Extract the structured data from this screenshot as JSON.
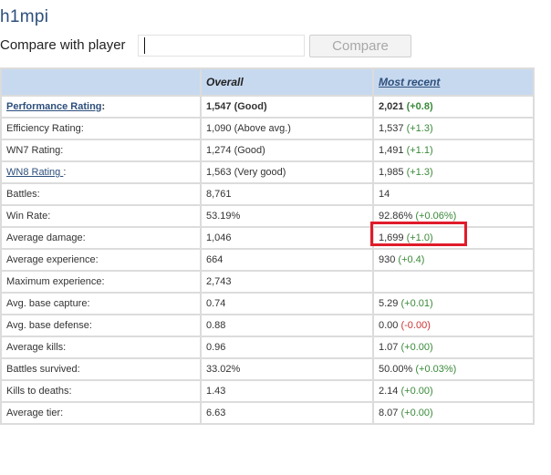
{
  "player": {
    "name": "h1mpi"
  },
  "compare": {
    "label": "Compare with player",
    "input_value": "",
    "placeholder": "",
    "button_label": "Compare"
  },
  "table": {
    "headers": {
      "label": "",
      "overall": "Overall",
      "recent": "Most recent"
    },
    "rows": [
      {
        "label": "Performance Rating",
        "label_suffix": ":",
        "overall": "1,547 (Good)",
        "recent_value": "2,021",
        "recent_delta": "(+0.8)"
      },
      {
        "label": "Efficiency Rating:",
        "label_suffix": "",
        "overall": "1,090 (Above avg.)",
        "recent_value": "1,537",
        "recent_delta": "(+1.3)"
      },
      {
        "label": "WN7 Rating:",
        "label_suffix": "",
        "overall": "1,274 (Good)",
        "recent_value": "1,491",
        "recent_delta": "(+1.1)"
      },
      {
        "label": "WN8 Rating ",
        "label_suffix": ":",
        "overall": "1,563 (Very good)",
        "recent_value": "1,985",
        "recent_delta": "(+1.3)"
      },
      {
        "label": "Battles:",
        "label_suffix": "",
        "overall": "8,761",
        "recent_value": "14",
        "recent_delta": ""
      },
      {
        "label": "Win Rate:",
        "label_suffix": "",
        "overall": "53.19%",
        "recent_value": "92.86%",
        "recent_delta": "(+0.06%)"
      },
      {
        "label": "Average damage:",
        "label_suffix": "",
        "overall": "1,046",
        "recent_value": "1,699",
        "recent_delta": "(+1.0)"
      },
      {
        "label": "Average experience:",
        "label_suffix": "",
        "overall": "664",
        "recent_value": "930",
        "recent_delta": "(+0.4)"
      },
      {
        "label": "Maximum experience:",
        "label_suffix": "",
        "overall": "2,743",
        "recent_value": "",
        "recent_delta": ""
      },
      {
        "label": "Avg. base capture:",
        "label_suffix": "",
        "overall": "0.74",
        "recent_value": "5.29",
        "recent_delta": "(+0.01)"
      },
      {
        "label": "Avg. base defense:",
        "label_suffix": "",
        "overall": "0.88",
        "recent_value": "0.00",
        "recent_delta": "(-0.00)"
      },
      {
        "label": "Average kills:",
        "label_suffix": "",
        "overall": "0.96",
        "recent_value": "1.07",
        "recent_delta": "(+0.00)"
      },
      {
        "label": "Battles survived:",
        "label_suffix": "",
        "overall": "33.02%",
        "recent_value": "50.00%",
        "recent_delta": "(+0.03%)"
      },
      {
        "label": "Kills to deaths:",
        "label_suffix": "",
        "overall": "1.43",
        "recent_value": "2.14",
        "recent_delta": "(+0.00)"
      },
      {
        "label": "Average tier:",
        "label_suffix": "",
        "overall": "6.63",
        "recent_value": "8.07",
        "recent_delta": "(+0.00)"
      }
    ]
  },
  "colors": {
    "header_bg": "#c7d9ef",
    "link": "#2c4f7c",
    "positive": "#3a8a3a",
    "negative": "#cc3333",
    "highlight": "#e01b2a"
  }
}
